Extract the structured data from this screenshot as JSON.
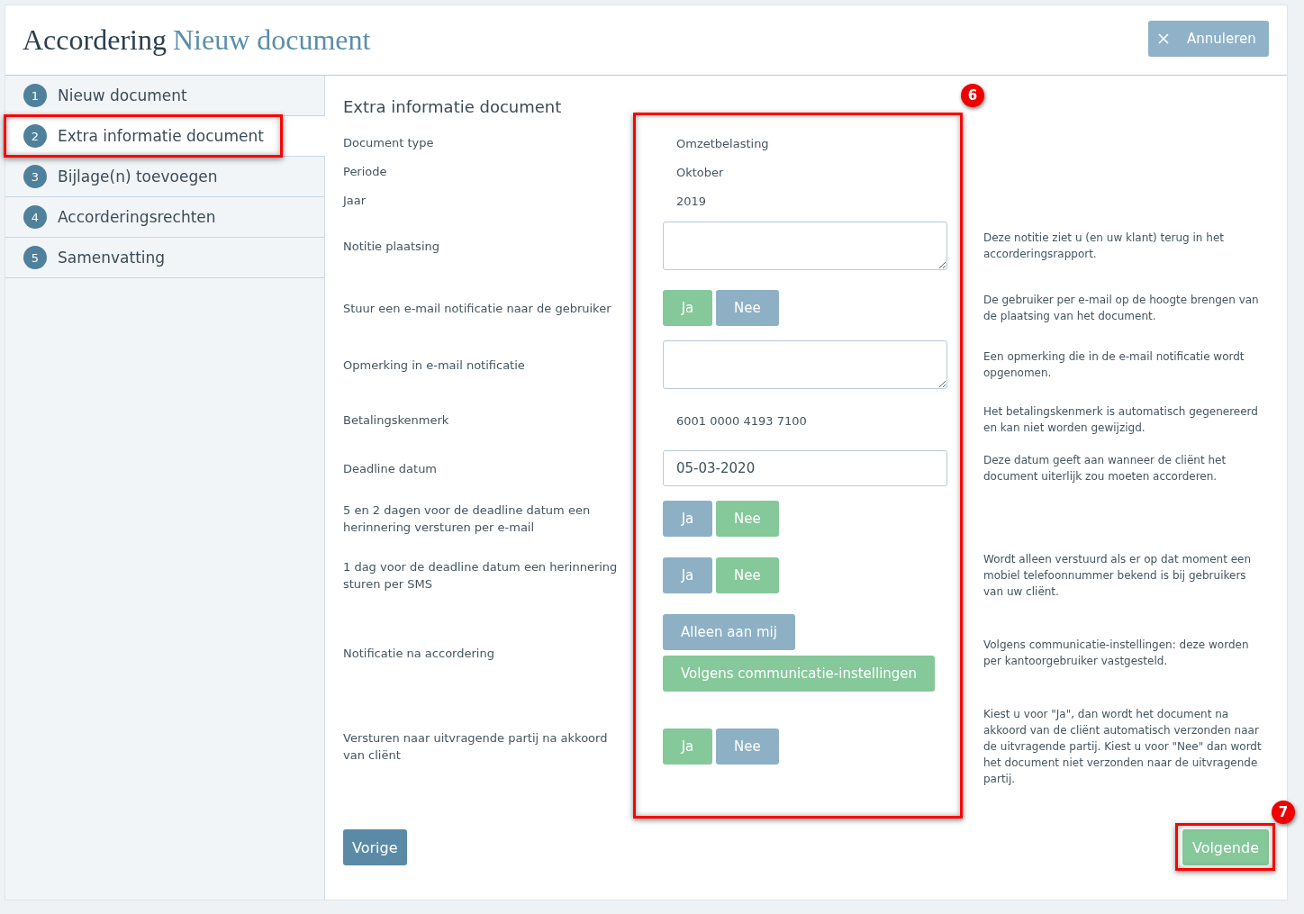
{
  "header": {
    "title": "Accordering",
    "document": "Nieuw document",
    "cancel_button": "Annuleren"
  },
  "steps": [
    {
      "number": "1",
      "label": "Nieuw document",
      "selected": false,
      "highlighted": false
    },
    {
      "number": "2",
      "label": "Extra informatie document",
      "selected": true,
      "highlighted": true
    },
    {
      "number": "3",
      "label": "Bijlage(n) toevoegen",
      "selected": false,
      "highlighted": false
    },
    {
      "number": "4",
      "label": "Accorderingsrechten",
      "selected": false,
      "highlighted": false
    },
    {
      "number": "5",
      "label": "Samenvatting",
      "selected": false,
      "highlighted": false
    }
  ],
  "form": {
    "title": "Extra informatie document",
    "highlight": {
      "callout": "6"
    },
    "rows": [
      {
        "kind": "text",
        "label": "Document type",
        "value": "Omzetbelasting"
      },
      {
        "kind": "text",
        "label": "Periode",
        "value": "Oktober"
      },
      {
        "kind": "text",
        "label": "Jaar",
        "value": "2019"
      },
      {
        "kind": "textarea",
        "label": "Notitie plaatsing",
        "help": "Deze notitie ziet u (en uw klant) terug in het accorderingsrapport."
      },
      {
        "kind": "toggle",
        "label": "Stuur een e-mail notificatie naar de gebruiker",
        "options": [
          {
            "label": "Ja",
            "selected": true
          },
          {
            "label": "Nee",
            "selected": false
          }
        ],
        "help": "De gebruiker per e-mail op de hoogte brengen van de plaatsing van het document."
      },
      {
        "kind": "textarea",
        "label": "Opmerking in e-mail notificatie",
        "help": "Een opmerking die in de e-mail notificatie wordt opgenomen."
      },
      {
        "kind": "text",
        "label": "Betalingskenmerk",
        "value": "6001 0000 4193 7100",
        "help": "Het betalingskenmerk is automatisch gegenereerd en kan niet worden gewijzigd."
      },
      {
        "kind": "input",
        "label": "Deadline datum",
        "value": "05-03-2020",
        "help": "Deze datum geeft aan wanneer de cliënt het document uiterlijk zou moeten accorderen."
      },
      {
        "kind": "toggle",
        "label": "5 en 2 dagen voor de deadline datum een herinnering versturen per e-mail",
        "options": [
          {
            "label": "Ja",
            "selected": false
          },
          {
            "label": "Nee",
            "selected": true
          }
        ]
      },
      {
        "kind": "toggle",
        "label": "1 dag voor de deadline datum een herinnering sturen per SMS",
        "options": [
          {
            "label": "Ja",
            "selected": false
          },
          {
            "label": "Nee",
            "selected": true
          }
        ],
        "help": "Wordt alleen verstuurd als er op dat moment een mobiel telefoonnummer bekend is bij gebruikers van uw cliënt."
      },
      {
        "kind": "stacked",
        "label": "Notificatie na accordering",
        "options": [
          {
            "label": "Alleen aan mij",
            "selected": false
          },
          {
            "label": "Volgens communicatie-instellingen",
            "selected": true
          }
        ],
        "help": "Volgens communicatie-instellingen: deze worden per kantoorgebruiker vastgesteld."
      },
      {
        "kind": "toggle",
        "label": "Versturen naar uitvragende partij na akkoord van cliënt",
        "options": [
          {
            "label": "Ja",
            "selected": true
          },
          {
            "label": "Nee",
            "selected": false
          }
        ],
        "help": "Kiest u voor \"Ja\", dan wordt het document na akkoord van de cliënt automatisch verzonden naar de uitvragende partij. Kiest u voor \"Nee\" dan wordt het document niet verzonden naar de uitvragende partij."
      }
    ]
  },
  "footer": {
    "previous_button": "Vorige",
    "next_button": {
      "label": "Volgende",
      "highlight": {
        "callout": "7"
      }
    }
  }
}
